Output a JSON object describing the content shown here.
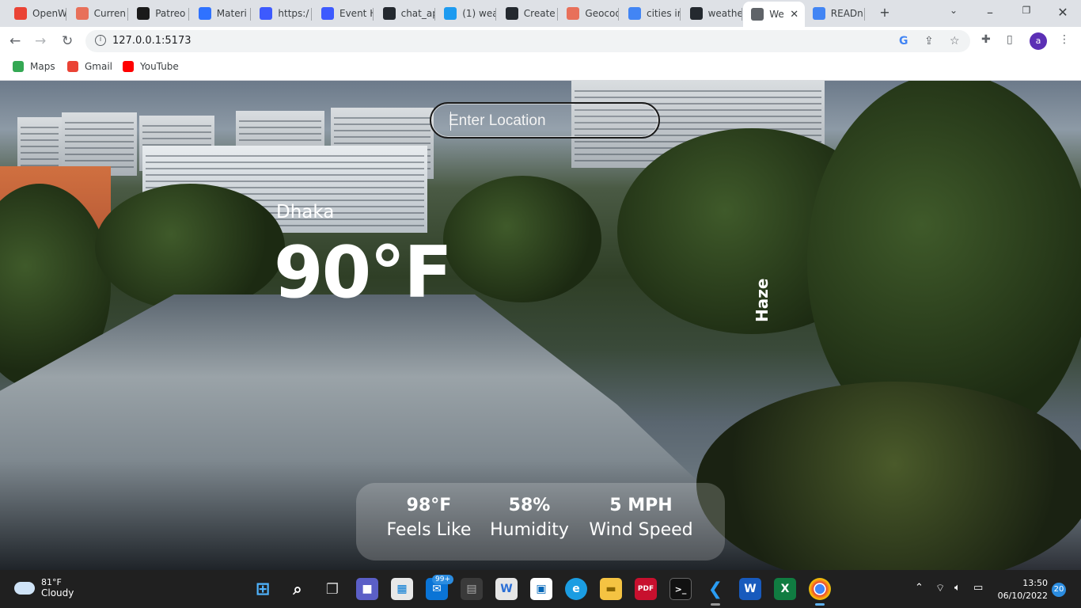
{
  "browser": {
    "tabs": [
      {
        "label": "OpenW",
        "icon": "gmail-icon",
        "color": "#ea4335"
      },
      {
        "label": "Curren",
        "icon": "cloud-icon",
        "color": "#e8705a"
      },
      {
        "label": "Patreo",
        "icon": "patreon-icon",
        "color": "#1a1a1a"
      },
      {
        "label": "Materi",
        "icon": "material-icon",
        "color": "#2f72ff"
      },
      {
        "label": "https:/",
        "icon": "paw-icon",
        "color": "#3d5afe"
      },
      {
        "label": "Event H",
        "icon": "paw-icon",
        "color": "#3d5afe"
      },
      {
        "label": "chat_ap",
        "icon": "github-icon",
        "color": "#24292f"
      },
      {
        "label": "(1) wea",
        "icon": "twitter-icon",
        "color": "#1d9bf0"
      },
      {
        "label": "Create",
        "icon": "github-icon",
        "color": "#24292f"
      },
      {
        "label": "Geocod",
        "icon": "cloud-icon",
        "color": "#e8705a"
      },
      {
        "label": "cities ir",
        "icon": "google-icon",
        "color": "#4285f4"
      },
      {
        "label": "weathe",
        "icon": "github-icon",
        "color": "#24292f"
      },
      {
        "label": "We",
        "icon": "globe-icon",
        "color": "#5f6368"
      },
      {
        "label": "READn",
        "icon": "google-icon",
        "color": "#4285f4"
      }
    ],
    "url": "127.0.0.1:5173",
    "avatar_letter": "a",
    "bookmarks": [
      {
        "label": "Maps",
        "icon": "maps-icon",
        "color": "#34a853"
      },
      {
        "label": "Gmail",
        "icon": "gmail-icon",
        "color": "#ea4335"
      },
      {
        "label": "YouTube",
        "icon": "youtube-icon",
        "color": "#ff0000"
      }
    ]
  },
  "app": {
    "search_placeholder": "Enter Location",
    "city": "Dhaka",
    "temperature": "90°F",
    "condition": "Haze",
    "stats": [
      {
        "value": "98°F",
        "label": "Feels Like"
      },
      {
        "value": "58%",
        "label": "Humidity"
      },
      {
        "value": "5 MPH",
        "label": "Wind Speed"
      }
    ]
  },
  "taskbar": {
    "weather_temp": "81°F",
    "weather_desc": "Cloudy",
    "mail_badge": "99+",
    "time": "13:50",
    "date": "06/10/2022",
    "notifications": "20"
  }
}
